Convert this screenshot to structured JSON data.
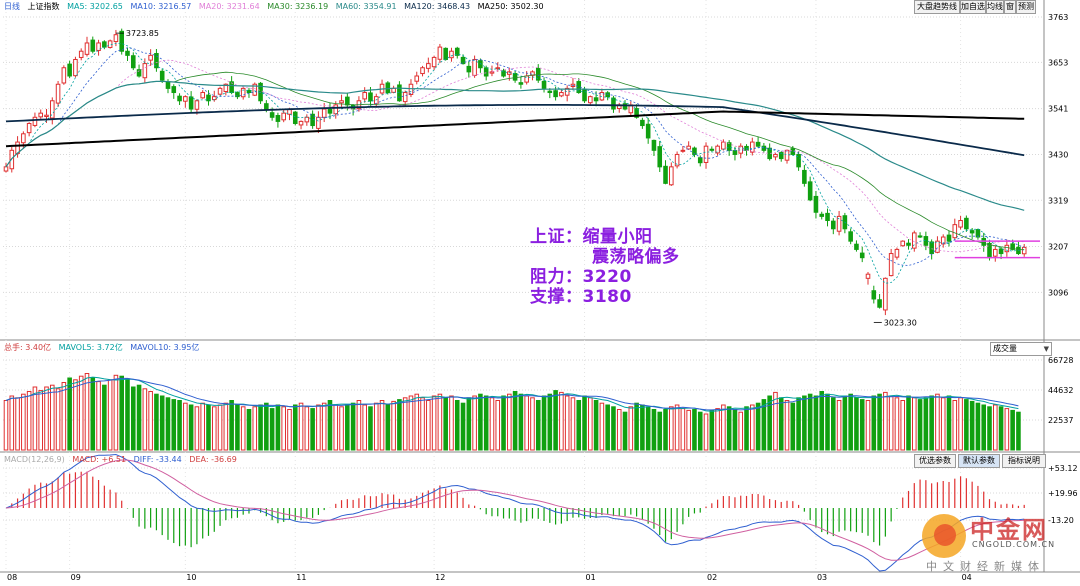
{
  "header": {
    "period": "日线",
    "index": "上证指数",
    "ma": [
      {
        "label": "MA5: 3202.65",
        "color": "#00a0a0"
      },
      {
        "label": "MA10: 3216.57",
        "color": "#3060d0"
      },
      {
        "label": "MA20: 3231.64",
        "color": "#e07fd7"
      },
      {
        "label": "MA30: 3236.19",
        "color": "#2a8a2a"
      },
      {
        "label": "MA60: 3354.91",
        "color": "#2a8a8a"
      },
      {
        "label": "MA120: 3468.43",
        "color": "#0a2a4a"
      },
      {
        "label": "MA250: 3502.30",
        "color": "#000000"
      }
    ],
    "buttons": [
      "大盘趋势线",
      "加自选",
      "均线",
      "窗",
      "预测"
    ]
  },
  "annotation": {
    "line1": "上证：缩量小阳",
    "line2": "震荡略偏多",
    "line3": "阻力：3220",
    "line4": "支撑：3180"
  },
  "volume_header": {
    "items": [
      {
        "label": "总手: 3.40亿",
        "color": "#d04040"
      },
      {
        "label": "MAVOL5: 3.72亿",
        "color": "#00a0a0"
      },
      {
        "label": "MAVOL10: 3.95亿",
        "color": "#3060d0"
      }
    ],
    "dropdown": "成交量"
  },
  "macd_header": {
    "items": [
      {
        "label": "MACD(12,26,9)",
        "color": "#aaaaaa"
      },
      {
        "label": "MACD: +6.51",
        "color": "#d04040"
      },
      {
        "label": "DIFF: -33.44",
        "color": "#3060d0"
      },
      {
        "label": "DEA: -36.69",
        "color": "#d04040"
      }
    ],
    "buttons": [
      "优选参数",
      "默认参数",
      "指标说明"
    ]
  },
  "logo": {
    "name": "中金网",
    "url": "CNGOLD.COM.CN",
    "tagline": "中文财经新媒体"
  },
  "chart_data": {
    "type": "candlestick",
    "price_axis": {
      "ticks": [
        3763,
        3653,
        3541,
        3430,
        3319,
        3207,
        3096
      ],
      "range": [
        3000,
        3775
      ]
    },
    "volume_axis": {
      "ticks": [
        "66728",
        "44632",
        "22537"
      ]
    },
    "macd_axis": {
      "ticks": [
        "+53.12",
        "+19.96",
        "-13.20"
      ]
    },
    "x_ticks": [
      {
        "label": "08",
        "i": 0
      },
      {
        "label": "09",
        "i": 11
      },
      {
        "label": "10",
        "i": 31
      },
      {
        "label": "11",
        "i": 50
      },
      {
        "label": "12",
        "i": 74
      },
      {
        "label": "01",
        "i": 100
      },
      {
        "label": "02",
        "i": 121
      },
      {
        "label": "03",
        "i": 140
      },
      {
        "label": "04",
        "i": 165
      }
    ],
    "annotations": [
      {
        "label": "3723.85",
        "i": 19,
        "price": 3723.85
      },
      {
        "label": "3023.30",
        "i": 150,
        "price": 3023.3
      }
    ],
    "resistance": 3220,
    "support": 3180,
    "close": [
      3400,
      3440,
      3460,
      3480,
      3505,
      3520,
      3530,
      3525,
      3560,
      3600,
      3640,
      3620,
      3660,
      3680,
      3700,
      3680,
      3700,
      3690,
      3705,
      3720,
      3680,
      3670,
      3640,
      3620,
      3650,
      3670,
      3640,
      3610,
      3590,
      3580,
      3560,
      3570,
      3540,
      3560,
      3580,
      3560,
      3570,
      3590,
      3600,
      3580,
      3570,
      3590,
      3580,
      3600,
      3560,
      3540,
      3520,
      3510,
      3530,
      3540,
      3505,
      3510,
      3520,
      3500,
      3520,
      3540,
      3530,
      3550,
      3560,
      3550,
      3540,
      3560,
      3580,
      3560,
      3570,
      3600,
      3580,
      3590,
      3560,
      3580,
      3600,
      3620,
      3640,
      3650,
      3665,
      3690,
      3660,
      3680,
      3670,
      3650,
      3630,
      3660,
      3640,
      3620,
      3630,
      3640,
      3620,
      3630,
      3610,
      3600,
      3620,
      3630,
      3610,
      3590,
      3580,
      3570,
      3580,
      3590,
      3600,
      3580,
      3560,
      3570,
      3560,
      3580,
      3570,
      3540,
      3550,
      3540,
      3550,
      3520,
      3500,
      3470,
      3440,
      3400,
      3360,
      3400,
      3430,
      3440,
      3450,
      3430,
      3410,
      3450,
      3440,
      3450,
      3460,
      3440,
      3430,
      3450,
      3440,
      3460,
      3450,
      3440,
      3420,
      3430,
      3420,
      3440,
      3430,
      3400,
      3360,
      3320,
      3290,
      3280,
      3270,
      3250,
      3280,
      3250,
      3220,
      3200,
      3180,
      3140,
      3080,
      3060,
      3130,
      3190,
      3200,
      3220,
      3210,
      3240,
      3230,
      3210,
      3190,
      3220,
      3230,
      3220,
      3260,
      3270,
      3250,
      3240,
      3230,
      3210,
      3180,
      3200,
      3190,
      3210,
      3200,
      3190,
      3205
    ],
    "volume_index_note": "per-candle volume ratios 0-1 of volume-axis top",
    "volume": [
      0.55,
      0.6,
      0.58,
      0.62,
      0.65,
      0.7,
      0.66,
      0.7,
      0.72,
      0.68,
      0.75,
      0.8,
      0.78,
      0.82,
      0.85,
      0.8,
      0.76,
      0.72,
      0.78,
      0.83,
      0.82,
      0.79,
      0.7,
      0.72,
      0.68,
      0.65,
      0.62,
      0.6,
      0.58,
      0.56,
      0.55,
      0.52,
      0.5,
      0.48,
      0.52,
      0.5,
      0.48,
      0.5,
      0.52,
      0.55,
      0.5,
      0.48,
      0.45,
      0.48,
      0.5,
      0.52,
      0.46,
      0.5,
      0.48,
      0.45,
      0.5,
      0.52,
      0.48,
      0.46,
      0.5,
      0.52,
      0.55,
      0.5,
      0.48,
      0.5,
      0.52,
      0.55,
      0.5,
      0.48,
      0.52,
      0.55,
      0.5,
      0.54,
      0.56,
      0.58,
      0.6,
      0.62,
      0.58,
      0.55,
      0.6,
      0.62,
      0.58,
      0.6,
      0.55,
      0.52,
      0.58,
      0.6,
      0.62,
      0.6,
      0.58,
      0.55,
      0.6,
      0.62,
      0.65,
      0.62,
      0.6,
      0.58,
      0.55,
      0.6,
      0.62,
      0.66,
      0.64,
      0.6,
      0.58,
      0.55,
      0.6,
      0.58,
      0.55,
      0.52,
      0.5,
      0.48,
      0.45,
      0.42,
      0.48,
      0.52,
      0.5,
      0.48,
      0.45,
      0.42,
      0.45,
      0.48,
      0.5,
      0.46,
      0.44,
      0.45,
      0.42,
      0.4,
      0.44,
      0.46,
      0.5,
      0.48,
      0.45,
      0.42,
      0.48,
      0.5,
      0.52,
      0.56,
      0.6,
      0.64,
      0.58,
      0.55,
      0.52,
      0.58,
      0.6,
      0.62,
      0.6,
      0.65,
      0.62,
      0.58,
      0.55,
      0.6,
      0.62,
      0.58,
      0.56,
      0.55,
      0.6,
      0.62,
      0.64,
      0.6,
      0.58,
      0.55,
      0.6,
      0.58,
      0.56,
      0.58,
      0.6,
      0.62,
      0.58,
      0.6,
      0.55,
      0.58,
      0.56,
      0.54,
      0.52,
      0.5,
      0.48,
      0.5,
      0.48,
      0.46,
      0.44,
      0.42
    ]
  }
}
